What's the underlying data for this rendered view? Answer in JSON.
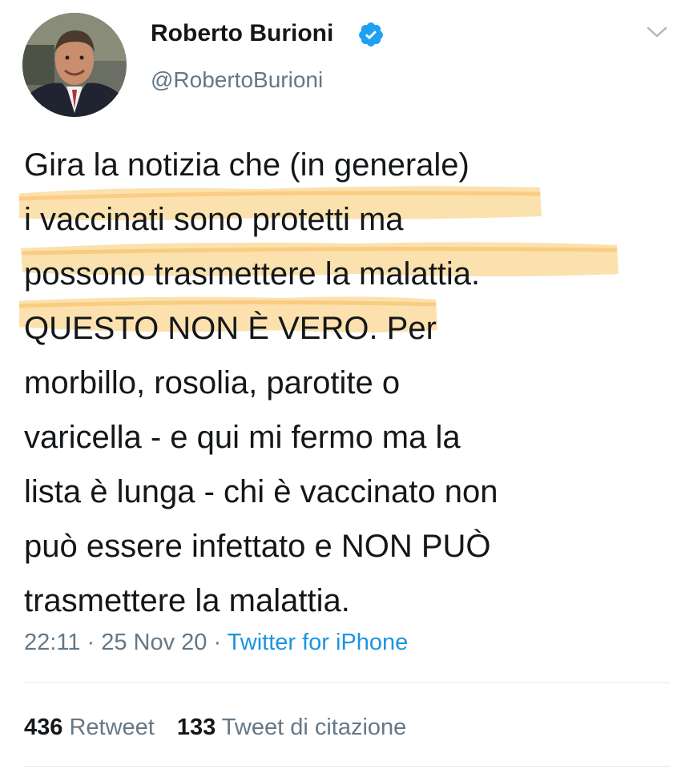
{
  "author": {
    "display_name": "Roberto Burioni",
    "handle": "@RobertoBurioni",
    "verified": true,
    "avatar_icon": "profile-photo"
  },
  "tweet": {
    "lines": [
      "Gira la notizia che (in generale)",
      "i vaccinati sono protetti ma",
      "possono trasmettere la malattia.",
      "QUESTO NON È VERO. Per",
      "morbillo, rosolia, parotite o",
      "varicella - e qui mi fermo ma la",
      "lista è lunga - chi è vaccinato non",
      "può essere infettato e NON PUÒ",
      "trasmettere la malattia."
    ],
    "highlight_color": "#f9c96b"
  },
  "meta": {
    "time": "22:11",
    "sep1": " · ",
    "date": "25 Nov 20",
    "sep2": " · ",
    "source": "Twitter for iPhone"
  },
  "stats": {
    "retweets_count": "436",
    "retweets_label": "Retweet",
    "quotes_count": "133",
    "quotes_label": "Tweet di citazione"
  },
  "colors": {
    "text": "#14171a",
    "secondary": "#657786",
    "link": "#1b95e0",
    "verified_badge": "#1da1f2",
    "divider": "#e1e8ed"
  }
}
